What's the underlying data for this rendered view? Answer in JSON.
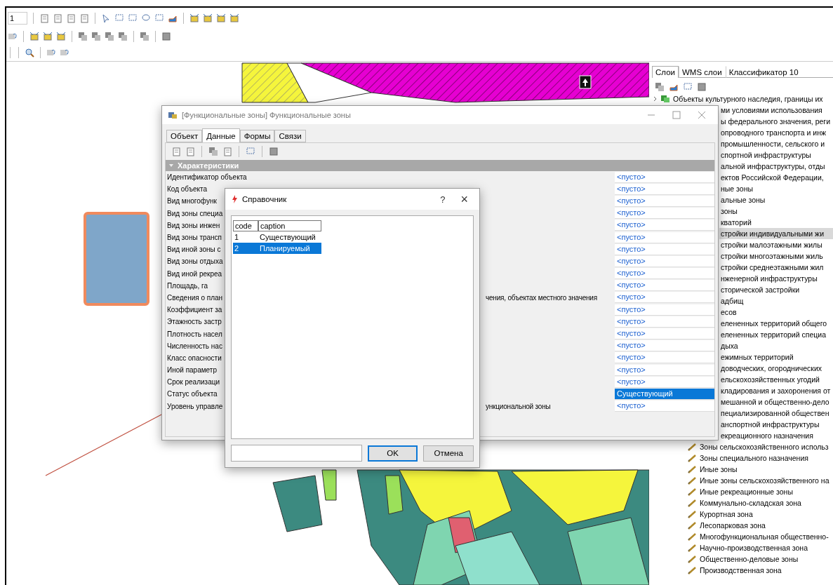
{
  "toolbar": {
    "field_value": "1"
  },
  "layers_panel": {
    "tabs": [
      {
        "label": "Слои",
        "selected": true
      },
      {
        "label": "WMS слои",
        "selected": false
      },
      {
        "label": "Классификатор 10",
        "selected": false
      }
    ],
    "items": [
      {
        "kind": "group",
        "label": "Объекты культурного наследия, границы их",
        "selected": false
      },
      {
        "kind": "clipped",
        "label": "ми условиями использования",
        "selected": false
      },
      {
        "kind": "clipped",
        "label": "ы федерального значения, реги",
        "selected": false
      },
      {
        "kind": "clipped",
        "label": "опроводного транспорта и инж",
        "selected": false
      },
      {
        "kind": "clipped",
        "label": "промышленности, сельского и",
        "selected": false
      },
      {
        "kind": "clipped",
        "label": "спортной инфраструктуры",
        "selected": false
      },
      {
        "kind": "clipped",
        "label": "альной инфраструктуры, отды",
        "selected": false
      },
      {
        "kind": "clipped",
        "label": "ектов Российской Федерации,",
        "selected": false
      },
      {
        "kind": "clipped",
        "label": "ные зоны",
        "selected": false
      },
      {
        "kind": "clipped",
        "label": "альные зоны",
        "selected": false
      },
      {
        "kind": "clipped",
        "label": "зоны",
        "selected": false
      },
      {
        "kind": "clipped",
        "label": "кваторий",
        "selected": false
      },
      {
        "kind": "clipped",
        "label": "стройки индивидуальными жи",
        "selected": true
      },
      {
        "kind": "clipped",
        "label": "стройки малоэтажными жилы",
        "selected": false
      },
      {
        "kind": "clipped",
        "label": "стройки многоэтажными жиль",
        "selected": false
      },
      {
        "kind": "clipped",
        "label": "стройки среднеэтажными жил",
        "selected": false
      },
      {
        "kind": "clipped",
        "label": "нженерной инфраструктуры",
        "selected": false
      },
      {
        "kind": "clipped",
        "label": "сторической застройки",
        "selected": false
      },
      {
        "kind": "clipped",
        "label": "адбищ",
        "selected": false
      },
      {
        "kind": "clipped",
        "label": "есов",
        "selected": false
      },
      {
        "kind": "clipped",
        "label": "елененных территорий общего",
        "selected": false
      },
      {
        "kind": "clipped",
        "label": "елененных территорий специа",
        "selected": false
      },
      {
        "kind": "clipped",
        "label": "дыха",
        "selected": false
      },
      {
        "kind": "clipped",
        "label": "ежимных территорий",
        "selected": false
      },
      {
        "kind": "clipped",
        "label": "доводческих, огороднических",
        "selected": false
      },
      {
        "kind": "clipped",
        "label": "ельскохозяйственных угодий",
        "selected": false
      },
      {
        "kind": "clipped",
        "label": "кладирования и захоронения от",
        "selected": false
      },
      {
        "kind": "clipped",
        "label": "мешанной и общественно-дело",
        "selected": false
      },
      {
        "kind": "clipped",
        "label": "пециализированной обществен",
        "selected": false
      },
      {
        "kind": "clipped",
        "label": "анспортной инфраструктуры",
        "selected": false
      },
      {
        "kind": "clipped",
        "label": "екреационного назначения",
        "selected": false
      },
      {
        "kind": "layer",
        "label": "Зоны сельскохозяйственного использ",
        "selected": false
      },
      {
        "kind": "layer",
        "label": "Зоны специального назначения",
        "selected": false
      },
      {
        "kind": "layer",
        "label": "Иные зоны",
        "selected": false
      },
      {
        "kind": "layer",
        "label": "Иные зоны сельскохозяйственного на",
        "selected": false
      },
      {
        "kind": "layer",
        "label": "Иные рекреационные зоны",
        "selected": false
      },
      {
        "kind": "layer",
        "label": "Коммунально-складская зона",
        "selected": false
      },
      {
        "kind": "layer",
        "label": "Курортная зона",
        "selected": false
      },
      {
        "kind": "layer",
        "label": "Лесопарковая зона",
        "selected": false
      },
      {
        "kind": "layer",
        "label": "Многофункциональная общественно-",
        "selected": false
      },
      {
        "kind": "layer",
        "label": "Научно-производственная зона",
        "selected": false
      },
      {
        "kind": "layer",
        "label": "Общественно-деловые зоны",
        "selected": false
      },
      {
        "kind": "layer",
        "label": "Производственная зона",
        "selected": false
      }
    ]
  },
  "feature_window": {
    "title": "[Функциональные зоны] Функциональные зоны",
    "tabs": [
      {
        "label": "Объект",
        "selected": false
      },
      {
        "label": "Данные",
        "selected": true
      },
      {
        "label": "Формы",
        "selected": false
      },
      {
        "label": "Связи",
        "selected": false
      }
    ],
    "section": {
      "title": "Характеристики",
      "expanded": true
    },
    "rows": [
      {
        "label": "Идентификатор объекта",
        "value": "<пусто>",
        "selected": false
      },
      {
        "label": "Код объекта",
        "value": "<пусто>",
        "selected": false
      },
      {
        "label": "Вид многофунк",
        "value": "<пусто>",
        "selected": false
      },
      {
        "label": "Вид зоны специа",
        "value": "<пусто>",
        "selected": false
      },
      {
        "label": "Вид зоны инжен",
        "value": "<пусто>",
        "selected": false
      },
      {
        "label": "Вид зоны трансп",
        "value": "<пусто>",
        "selected": false
      },
      {
        "label": "Вид иной зоны с",
        "value": "<пусто>",
        "selected": false
      },
      {
        "label": "Вид зоны отдыха",
        "value": "<пусто>",
        "selected": false
      },
      {
        "label": "Вид иной рекреа",
        "value": "<пусто>",
        "selected": false
      },
      {
        "label": "Площадь, га",
        "value": "<пусто>",
        "selected": false
      },
      {
        "label": "Сведения о план",
        "tail": "чения, объектах местного значения",
        "value": "<пусто>",
        "selected": false
      },
      {
        "label": "Коэффициент за",
        "value": "<пусто>",
        "selected": false
      },
      {
        "label": "Этажность застр",
        "value": "<пусто>",
        "selected": false
      },
      {
        "label": "Плотность насел",
        "value": "<пусто>",
        "selected": false
      },
      {
        "label": "Численность нас",
        "value": "<пусто>",
        "selected": false
      },
      {
        "label": "Класс опасности",
        "value": "<пусто>",
        "selected": false
      },
      {
        "label": "Иной параметр",
        "value": "<пусто>",
        "selected": false
      },
      {
        "label": "Срок реализаци",
        "value": "<пусто>",
        "selected": false
      },
      {
        "label": "Статус объекта",
        "value": "Существующий",
        "selected": true
      },
      {
        "label": "Уровень управле",
        "tail": "ункциональной зоны",
        "value": "<пусто>",
        "selected": false
      }
    ]
  },
  "lookup_dialog": {
    "title": "Справочник",
    "help": "?",
    "close": "×",
    "columns": [
      "code",
      "caption"
    ],
    "rows": [
      {
        "code": "1",
        "caption": "Существующий",
        "selected": false
      },
      {
        "code": "2",
        "caption": "Планируемый",
        "selected": true
      }
    ],
    "buttons": [
      {
        "label": "OK",
        "default": true
      },
      {
        "label": "Отмена",
        "default": false
      }
    ]
  }
}
